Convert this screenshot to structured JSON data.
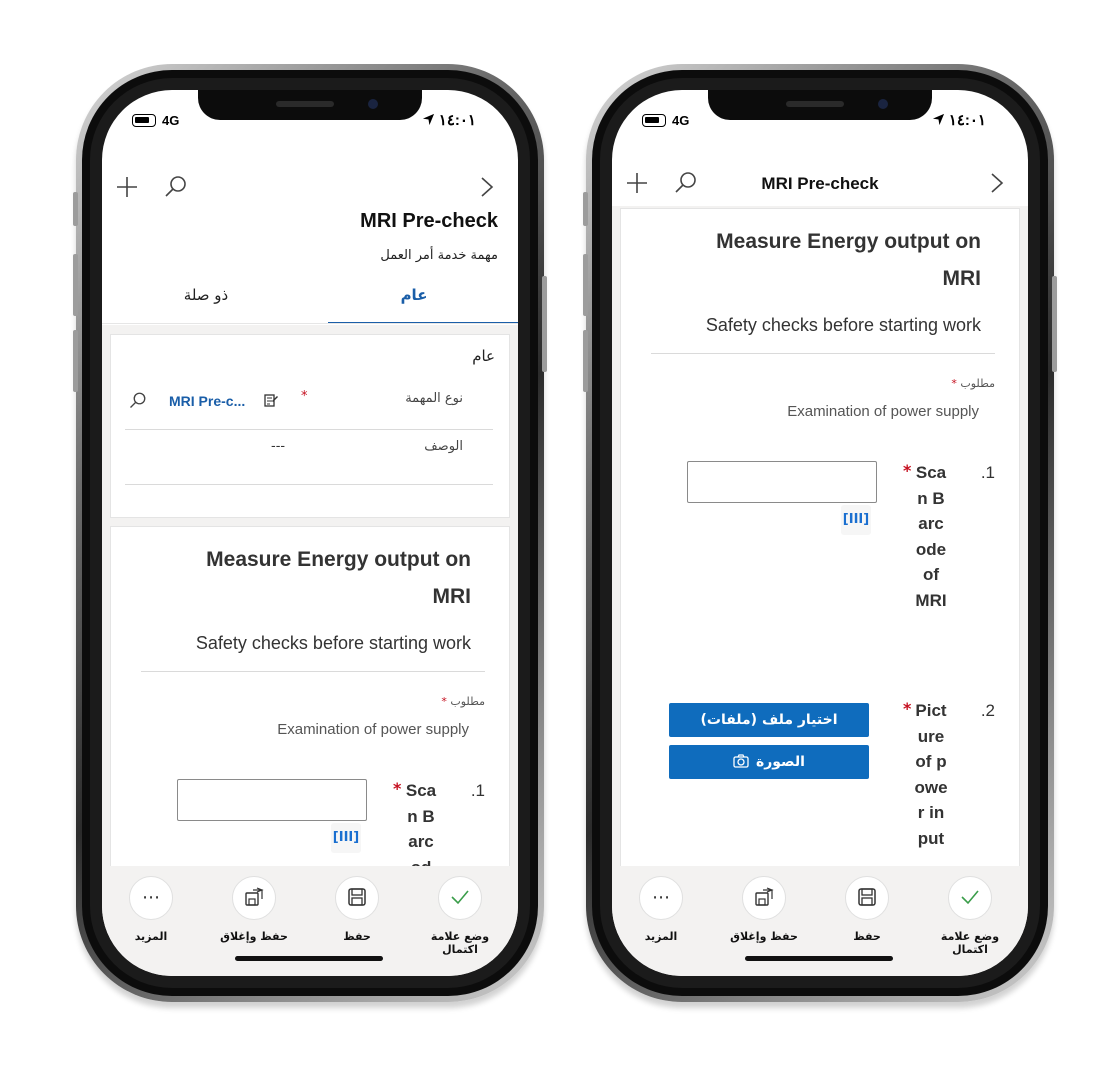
{
  "status_bar": {
    "network": "4G",
    "time": "١٤:٠١"
  },
  "left": {
    "header_title": "MRI Pre-check",
    "subtitle": "مهمة خدمة أمر العمل",
    "tabs": [
      {
        "label": "عام"
      },
      {
        "label": "ذو صلة"
      }
    ],
    "general_section": {
      "title": "عام",
      "task_type_label": "نوع المهمة",
      "task_type_value": "MRI Pre-c...",
      "description_label": "الوصف",
      "description_value": "---"
    },
    "card": {
      "title_line1": "Measure Energy output on",
      "title_line2": "MRI",
      "subtitle": "Safety checks before starting work",
      "required_label": "مطلوب",
      "examination": "Examination of power supply",
      "q1_number": ".1",
      "q1_text": "Scan Barcod"
    }
  },
  "right": {
    "header_title": "MRI Pre-check",
    "card": {
      "title_line1": "Measure Energy output on",
      "title_line2": "MRI",
      "subtitle": "Safety checks before starting work",
      "required_label": "مطلوب",
      "examination": "Examination of power supply",
      "q1_number": ".1",
      "q1_text": "Scan Barcode of MRI",
      "q2_number": ".2",
      "q2_text": "Picture of power input",
      "choose_file_label": "اختيار ملف (ملفات)",
      "photo_label": "الصورة"
    }
  },
  "toolbar": {
    "mark_complete": "وضع علامة اكتمال",
    "save": "حفظ",
    "save_close": "حفظ وإغلاق",
    "more": "المزيد"
  },
  "colors": {
    "accent": "#0f6cbd",
    "required": "#c50f1f",
    "link": "#1a5ea8"
  }
}
